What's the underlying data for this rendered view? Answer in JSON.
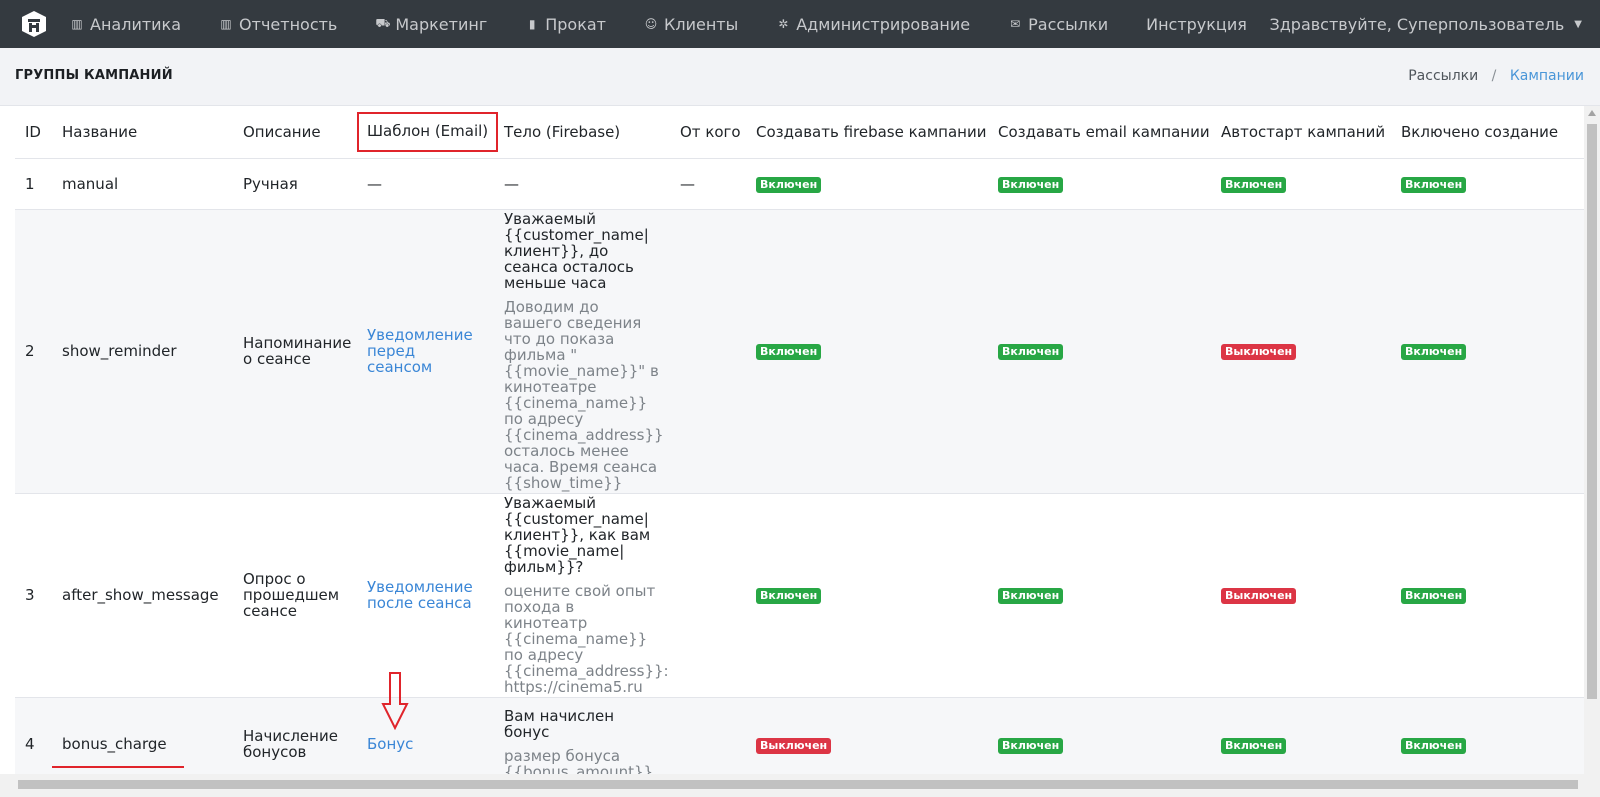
{
  "nav": {
    "items": [
      {
        "icon": "bar-chart-icon",
        "glyph": "▥",
        "label": "Аналитика"
      },
      {
        "icon": "bar-chart-icon",
        "glyph": "▥",
        "label": "Отчетность"
      },
      {
        "icon": "cart-icon",
        "glyph": "⛟",
        "label": "Маркетинг"
      },
      {
        "icon": "film-icon",
        "glyph": "▮",
        "label": "Прокат"
      },
      {
        "icon": "user-icon",
        "glyph": "☺",
        "label": "Клиенты"
      },
      {
        "icon": "gears-icon",
        "glyph": "✲",
        "label": "Администрирование"
      },
      {
        "icon": "envelope-icon",
        "glyph": "✉",
        "label": "Рассылки"
      },
      {
        "icon": "",
        "glyph": "",
        "label": "Инструкция"
      }
    ],
    "user_greeting": "Здравствуйте, Суперпользователь"
  },
  "header": {
    "title": "ГРУППЫ КАМПАНИЙ",
    "breadcrumb": {
      "parent": "Рассылки",
      "separator": "/",
      "current": "Кампании"
    }
  },
  "table": {
    "columns": [
      "ID",
      "Название",
      "Описание",
      "Шаблон (Email)",
      "Тело (Firebase)",
      "От кого",
      "Создавать firebase кампании",
      "Создавать email кампании",
      "Автостарт кампаний",
      "Включено создание"
    ],
    "rows": [
      {
        "id": "1",
        "name": "manual",
        "description": "Ручная",
        "template": "—",
        "body_title": "—",
        "body_text": "",
        "from": "—",
        "firebase": "Включен",
        "email": "Включен",
        "autostart": "Включен",
        "enabled": "Включен"
      },
      {
        "id": "2",
        "name": "show_reminder",
        "description": "Напоминание о сеансе",
        "template": "Уведомление перед сеансом",
        "body_title": "Уважаемый {{customer_name|клиент}}, до сеанса осталось меньше часа",
        "body_text": "Доводим до вашего сведения что до показа фильма \"{{movie_name}}\" в кинотеатре {{cinema_name}} по адресу {{cinema_address}} осталось менее часа. Время сеанса {{show_time}}",
        "from": "",
        "firebase": "Включен",
        "email": "Включен",
        "autostart": "Выключен",
        "enabled": "Включен"
      },
      {
        "id": "3",
        "name": "after_show_message",
        "description": "Опрос о прошедшем сеансе",
        "template": "Уведомление после сеанса",
        "body_title": "Уважаемый {{customer_name|клиент}}, как вам {{movie_name|фильм}}?",
        "body_text": "оцените свой опыт похода в кинотеатр {{cinema_name}} по адресу {{cinema_address}}: https://cinema5.ru",
        "from": "",
        "firebase": "Включен",
        "email": "Включен",
        "autostart": "Выключен",
        "enabled": "Включен"
      },
      {
        "id": "4",
        "name": "bonus_charge",
        "description": "Начисление бонусов",
        "template": "Бонус",
        "body_title": "Вам начислен бонус",
        "body_text": "размер бонуса {{bonus_amount}} истекает",
        "from": "",
        "firebase": "Выключен",
        "email": "Включен",
        "autostart": "Включен",
        "enabled": "Включен"
      }
    ]
  },
  "colors": {
    "navbar": "#343a40",
    "badge_on": "#28a745",
    "badge_off": "#dc3545",
    "link": "#3a86d6",
    "highlight": "#e0242b"
  }
}
